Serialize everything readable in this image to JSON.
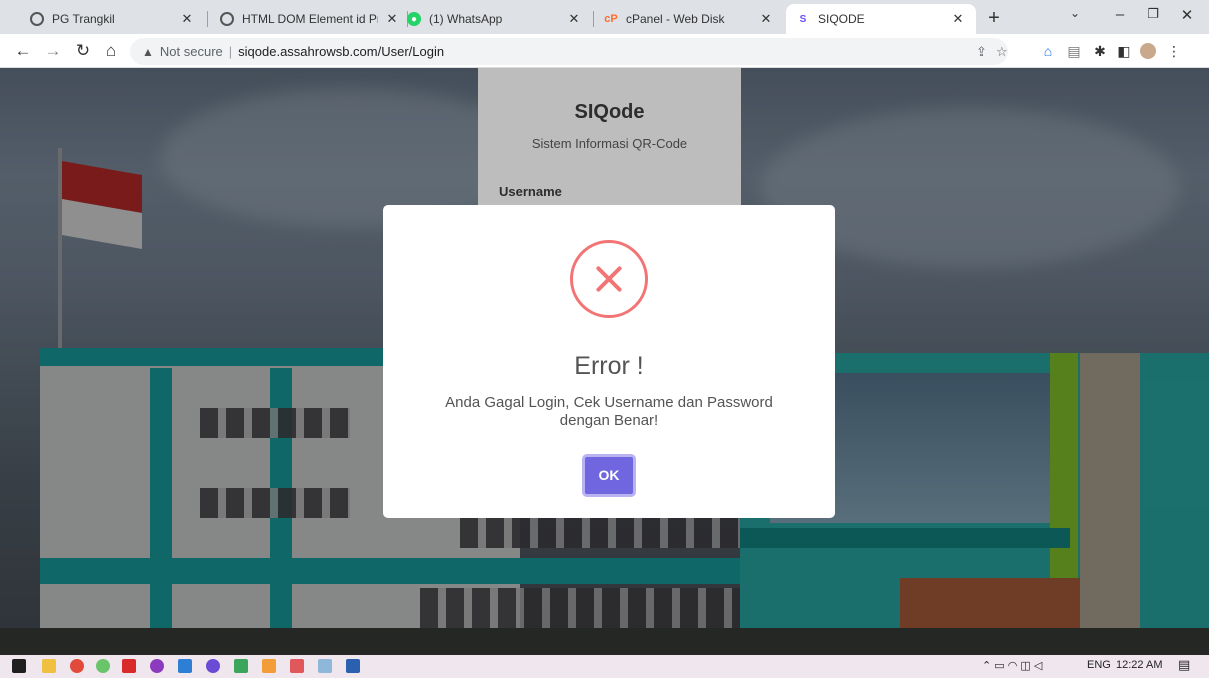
{
  "browser": {
    "tabs": [
      {
        "label": "PG Trangkil",
        "active": false
      },
      {
        "label": "HTML DOM Element id Prop",
        "active": false
      },
      {
        "label": "(1) WhatsApp",
        "active": false
      },
      {
        "label": "cPanel - Web Disk",
        "active": false
      },
      {
        "label": "SIQODE",
        "active": true
      }
    ],
    "new_tab_glyph": "+",
    "security_label": "Not secure",
    "url": "siqode.assahrowsb.com/User/Login"
  },
  "login": {
    "title": "SIQode",
    "subtitle": "Sistem Informasi QR-Code",
    "username_label": "Username"
  },
  "modal": {
    "title": "Error !",
    "message": "Anda Gagal Login, Cek Username dan Password dengan Benar!",
    "ok_label": "OK",
    "accent": "#7066e0",
    "error_color": "#f27474"
  },
  "taskbar": {
    "language": "ENG",
    "time": "12:22 AM"
  }
}
